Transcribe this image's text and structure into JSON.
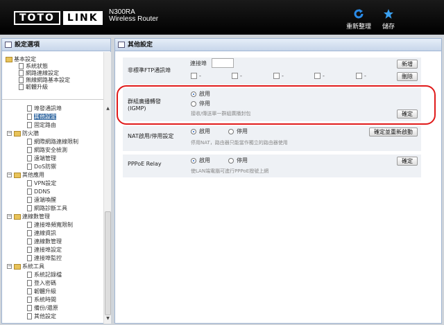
{
  "header": {
    "logo_left": "TOTO",
    "logo_right": "LINK",
    "model": "N300RA",
    "subtitle": "Wireless Router",
    "refresh_label": "重新整理",
    "save_label": "儲存"
  },
  "sidebar": {
    "title": "設定選項",
    "items": [
      {
        "label": "基本設定"
      },
      {
        "label": "系統狀態"
      },
      {
        "label": "網路連線設定"
      },
      {
        "label": "無線網路基本設定"
      },
      {
        "label": "韌體升級"
      },
      {
        "label": "埠發通訊埠"
      },
      {
        "label": "其他設定"
      },
      {
        "label": "固定路由"
      },
      {
        "label": "防火牆"
      },
      {
        "label": "網際網路連線限制"
      },
      {
        "label": "網路安全檢測"
      },
      {
        "label": "遠端管理"
      },
      {
        "label": "DoS防禦"
      },
      {
        "label": "其他應用"
      },
      {
        "label": "VPN設定"
      },
      {
        "label": "DDNS"
      },
      {
        "label": "遠端喚醒"
      },
      {
        "label": "網路診斷工具"
      },
      {
        "label": "連線數管理"
      },
      {
        "label": "連接埠頻寬限制"
      },
      {
        "label": "連線資訊"
      },
      {
        "label": "連線數管理"
      },
      {
        "label": "連接埠設定"
      },
      {
        "label": "連接埠監控"
      },
      {
        "label": "系統工具"
      },
      {
        "label": "系統記錄檔"
      },
      {
        "label": "登入密碼"
      },
      {
        "label": "韌體升級"
      },
      {
        "label": "系統時間"
      },
      {
        "label": "備份/還原"
      },
      {
        "label": "其他設定"
      }
    ]
  },
  "main": {
    "title": "其他設定",
    "ftp": {
      "label": "非標準FTP通訊埠",
      "port_label": "連接埠",
      "port_value": "",
      "add_label": "新增",
      "delete_label": "刪除",
      "slots": [
        "-",
        "-",
        "-",
        "-",
        "-"
      ]
    },
    "igmp": {
      "label_line1": "群組廣播轉發",
      "label_line2": "(IGMP)",
      "enable_label": "啟用",
      "disable_label": "停用",
      "hint": "接收/傳送單一群組廣播封包",
      "confirm_label": "確定",
      "selected": "enable"
    },
    "nat": {
      "label": "NAT啟用/停用設定",
      "enable_label": "啟用",
      "disable_label": "停用",
      "hint": "停用NAT，路由器只能當作獨立的路由器使用",
      "confirm_label": "確定並重新啟動",
      "selected": "enable"
    },
    "pppoe": {
      "label": "PPPoE Relay",
      "enable_label": "啟用",
      "disable_label": "停用",
      "hint": "使LAN端電腦可進行PPPoE撥號上網",
      "confirm_label": "確定",
      "selected": "enable"
    }
  },
  "colors": {
    "header_bg": "#000000",
    "panel_border": "#9fb5d3",
    "row_bg": "#eef1f5",
    "highlight": "#e01a1a",
    "selected_node": "#3a6ea5"
  }
}
